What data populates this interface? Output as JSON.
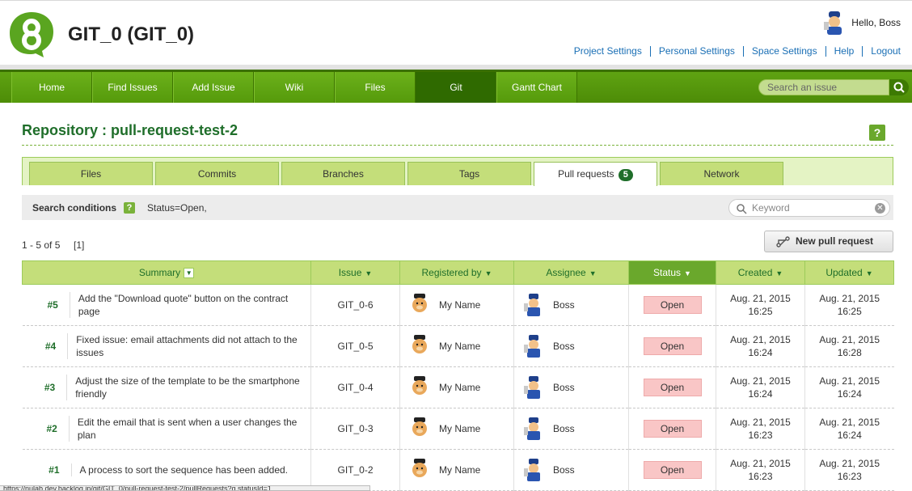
{
  "header": {
    "project_title": "GIT_0 (GIT_0)",
    "greeting": "Hello, Boss",
    "links": [
      "Project Settings",
      "Personal Settings",
      "Space Settings",
      "Help",
      "Logout"
    ]
  },
  "nav": {
    "items": [
      "Home",
      "Find Issues",
      "Add Issue",
      "Wiki",
      "Files",
      "Git",
      "Gantt Chart"
    ],
    "active": "Git",
    "search_placeholder": "Search an issue"
  },
  "repo": {
    "title": "Repository : pull-request-test-2",
    "help_label": "?"
  },
  "tabs": {
    "items": [
      "Files",
      "Commits",
      "Branches",
      "Tags",
      "Pull requests",
      "Network"
    ],
    "active": "Pull requests",
    "pull_request_count": "5"
  },
  "search_conditions": {
    "label": "Search conditions",
    "help_label": "?",
    "value": "Status=Open,",
    "keyword_placeholder": "Keyword"
  },
  "pagination": {
    "count_text": "1 - 5 of 5",
    "page_text": "[1]"
  },
  "new_pull_request_label": "New pull request",
  "table": {
    "columns": [
      "Summary",
      "Issue",
      "Registered by",
      "Assignee",
      "Status",
      "Created",
      "Updated"
    ],
    "rows": [
      {
        "num": "#5",
        "summary": "Add the \"Download quote\" button on the contract page",
        "issue": "GIT_0-6",
        "registered_by": "My Name",
        "assignee": "Boss",
        "status": "Open",
        "created_date": "Aug. 21, 2015",
        "created_time": "16:25",
        "updated_date": "Aug. 21, 2015",
        "updated_time": "16:25"
      },
      {
        "num": "#4",
        "summary": "Fixed issue: email attachments did not attach to the issues",
        "issue": "GIT_0-5",
        "registered_by": "My Name",
        "assignee": "Boss",
        "status": "Open",
        "created_date": "Aug. 21, 2015",
        "created_time": "16:24",
        "updated_date": "Aug. 21, 2015",
        "updated_time": "16:28"
      },
      {
        "num": "#3",
        "summary": "Adjust the size of the template to be the smartphone friendly",
        "issue": "GIT_0-4",
        "registered_by": "My Name",
        "assignee": "Boss",
        "status": "Open",
        "created_date": "Aug. 21, 2015",
        "created_time": "16:24",
        "updated_date": "Aug. 21, 2015",
        "updated_time": "16:24"
      },
      {
        "num": "#2",
        "summary": "Edit the email that is sent when a user changes the plan",
        "issue": "GIT_0-3",
        "registered_by": "My Name",
        "assignee": "Boss",
        "status": "Open",
        "created_date": "Aug. 21, 2015",
        "created_time": "16:23",
        "updated_date": "Aug. 21, 2015",
        "updated_time": "16:24"
      },
      {
        "num": "#1",
        "summary": "A process to sort the sequence has been added.",
        "issue": "GIT_0-2",
        "registered_by": "My Name",
        "assignee": "Boss",
        "status": "Open",
        "created_date": "Aug. 21, 2015",
        "created_time": "16:23",
        "updated_date": "Aug. 21, 2015",
        "updated_time": "16:23"
      }
    ]
  },
  "statusbar_text": "https://nulab.dev.backlog.jp/git/GIT_0/pull-request-test-2/pullRequests?q.statusId=1",
  "colors": {
    "brand_green": "#4d8c07",
    "title_green": "#1f6e2a",
    "status_open_bg": "#f9c6c6",
    "link_blue": "#1a6fb5"
  },
  "icons": [
    "backlog-logo-icon",
    "user-avatar-icon",
    "search-icon",
    "clear-icon",
    "help-icon",
    "pull-request-icon",
    "sort-arrow-icon",
    "my-name-avatar-icon",
    "boss-avatar-icon"
  ]
}
